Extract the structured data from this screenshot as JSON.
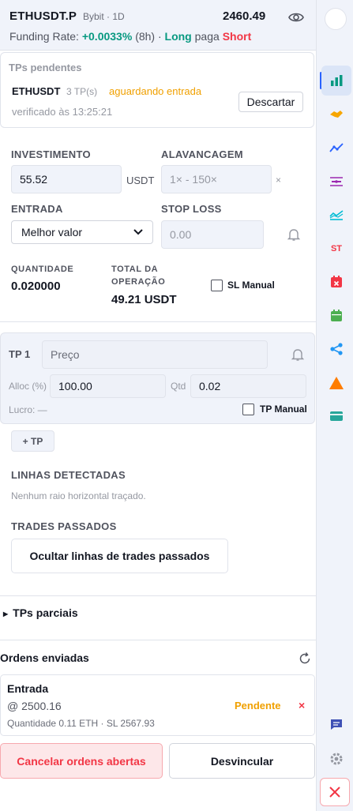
{
  "header": {
    "symbol": "ETHUSDT.P",
    "exchange_tf": "Bybit · 1D",
    "price": "2460.49",
    "funding_label": "Funding Rate:",
    "funding_rate": "+0.0033%",
    "funding_interval": "(8h) ·",
    "long_label": "Long",
    "pays_label": "paga",
    "short_label": "Short"
  },
  "pending": {
    "title": "TPs pendentes",
    "symbol": "ETHUSDT",
    "tps": "3 TP(s)",
    "status": "aguardando entrada",
    "checked": "verificado às 13:25:21",
    "discard_label": "Descartar"
  },
  "form": {
    "investment_label": "INVESTIMENTO",
    "investment_value": "55.52",
    "investment_unit": "USDT",
    "leverage_label": "ALAVANCAGEM",
    "leverage_placeholder": "1× - 150×",
    "leverage_suffix": "×",
    "entry_label": "ENTRADA",
    "entry_value": "Melhor valor",
    "stoploss_label": "STOP LOSS",
    "stoploss_placeholder": "0.00",
    "quantity_label": "QUANTIDADE",
    "quantity_value": "0.020000",
    "total_label_1": "TOTAL DA",
    "total_label_2": "OPERAÇÃO",
    "total_value": "49.21 USDT",
    "sl_manual_label": "SL Manual"
  },
  "tp1": {
    "title": "TP 1",
    "price_placeholder": "Preço",
    "alloc_label": "Alloc (%)",
    "alloc_value": "100.00",
    "qtd_label": "Qtd",
    "qtd_value": "0.02",
    "profit_label": "Lucro: —",
    "tp_manual_label": "TP Manual"
  },
  "add_tp_label": "+ TP",
  "detected": {
    "title": "LINHAS DETECTADAS",
    "empty": "Nenhum raio horizontal traçado."
  },
  "past_trades": {
    "title": "TRADES PASSADOS",
    "hide_label": "Ocultar linhas de trades passados"
  },
  "partial_tps_label": "TPs parciais",
  "orders": {
    "title": "Ordens enviadas",
    "items": [
      {
        "name": "Entrada",
        "price": "@ 2500.16",
        "detail": "Quantidade 0.11 ETH · SL 2567.93",
        "status": "Pendente",
        "remove": "×"
      }
    ]
  },
  "actions": {
    "cancel_label": "Cancelar ordens abertas",
    "unlink_label": "Desvincular"
  },
  "toolbar": {
    "st_label": "ST",
    "icons": [
      "avatar-icon",
      "chart-bars-icon",
      "handshake-icon",
      "trend-line-icon",
      "horizontal-line-icon",
      "indicator-icon",
      "supertrend-icon",
      "calendar-x-icon",
      "calendar-icon",
      "share-icon",
      "warning-icon",
      "card-icon",
      "chat-icon",
      "settings-icon",
      "close-icon"
    ]
  },
  "colors": {
    "green": "#089981",
    "red": "#f23645",
    "orange": "#f0a000",
    "blue": "#2962ff"
  }
}
